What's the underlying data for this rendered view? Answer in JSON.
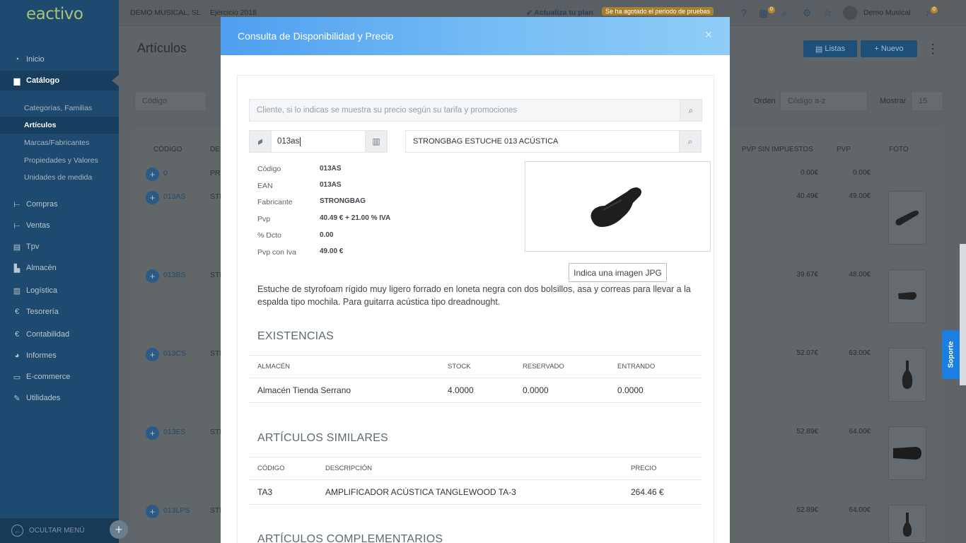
{
  "app": {
    "logo": "eactivo"
  },
  "sidebar": {
    "items": [
      {
        "label": "Inicio",
        "icon": "dashboard-icon"
      },
      {
        "label": "Catálogo",
        "icon": "book-icon",
        "active": true
      },
      {
        "label": "Compras",
        "icon": "cart-in-icon"
      },
      {
        "label": "Ventas",
        "icon": "cart-out-icon"
      },
      {
        "label": "Tpv",
        "icon": "register-icon"
      },
      {
        "label": "Almacén",
        "icon": "warehouse-icon"
      },
      {
        "label": "Logística",
        "icon": "barcode-icon"
      },
      {
        "label": "Tesorería",
        "icon": "euro-icon"
      },
      {
        "label": "Contabilidad",
        "icon": "euro-icon"
      },
      {
        "label": "Informes",
        "icon": "pie-icon"
      },
      {
        "label": "E-commerce",
        "icon": "window-icon"
      },
      {
        "label": "Utilidades",
        "icon": "wrench-icon"
      }
    ],
    "subitems": [
      "Categorías, Familias",
      "Artículos",
      "Marcas/Fabricantes",
      "Propiedades y Valores",
      "Unidades de medida"
    ],
    "hide_menu": "OCULTAR MENÚ"
  },
  "topbar": {
    "company": "DEMO MUSICAL, SL",
    "year": "Ejercicio 2018",
    "upgrade": "Actualiza tu plan",
    "trial": "Se ha agotado el periodo de pruebas",
    "calendar_badge": "0",
    "user": "Demo Musical",
    "notif_badge": "0"
  },
  "page": {
    "title": "Artículos",
    "btn_lists": "Listas",
    "btn_new": "Nuevo",
    "filter_field": "Código",
    "order_label": "Orden",
    "order_value": "Código a-z",
    "show_label": "Mostrar",
    "show_value": "15",
    "columns": [
      "CÓDIGO",
      "DES",
      "PVP SIN IMPUESTOS",
      "PVP",
      "FOTO"
    ],
    "rows": [
      {
        "code": "0",
        "desc": "PRU",
        "pvp_net": "0.00€",
        "pvp": "0.00€"
      },
      {
        "code": "013AS",
        "desc": "STR",
        "pvp_net": "40.49€",
        "pvp": "49.00€"
      },
      {
        "code": "013BS",
        "desc": "STR",
        "pvp_net": "39.67€",
        "pvp": "48.00€"
      },
      {
        "code": "013CS",
        "desc": "STR",
        "pvp_net": "52.07€",
        "pvp": "63.00€"
      },
      {
        "code": "013ES",
        "desc": "STR",
        "pvp_net": "52.89€",
        "pvp": "64.00€"
      },
      {
        "code": "013LPS",
        "desc": "STR",
        "pvp_net": "52.89€",
        "pvp": "64.00€"
      }
    ]
  },
  "support": "Soporte",
  "modal": {
    "title": "Consulta de Disponibilidad y Precio",
    "client_placeholder": "Cliente, si lo indicas se muestra su precio según su tarifa y promociones",
    "code_value": "013as",
    "product_value": "STRONGBAG ESTUCHE 013 ACÚSTICA",
    "fields": [
      {
        "k": "Código",
        "v": "013AS"
      },
      {
        "k": "EAN",
        "v": "013AS"
      },
      {
        "k": "Fabricante",
        "v": "STRONGBAG"
      },
      {
        "k": "Pvp",
        "v": "40.49 € + 21.00 % IVA"
      },
      {
        "k": "% Dcto",
        "v": "0.00"
      },
      {
        "k": "Pvp con Iva",
        "v": "49.00 €"
      }
    ],
    "image_button": "Indica una imagen JPG",
    "description": "Estuche de styrofoam rígido muy ligero forrado en loneta negra con dos bolsillos, asa y correas para llevar a la espalda tipo mochila. Para guitarra acústica tipo dreadnought.",
    "stock": {
      "title": "EXISTENCIAS",
      "headers": [
        "ALMACÉN",
        "STOCK",
        "RESERVADO",
        "ENTRANDO"
      ],
      "row": [
        "Almacén Tienda Serrano",
        "4.0000",
        "0.0000",
        "0.0000"
      ]
    },
    "similar": {
      "title": "ARTÍCULOS SIMILARES",
      "headers": [
        "CÓDIGO",
        "DESCRIPCIÓN",
        "PRECIO"
      ],
      "row": [
        "TA3",
        "AMPLIFICADOR ACÚSTICA TANGLEWOOD TA-3",
        "264.46 €"
      ]
    },
    "complementary_title": "ARTÍCULOS COMPLEMENTARIOS"
  }
}
